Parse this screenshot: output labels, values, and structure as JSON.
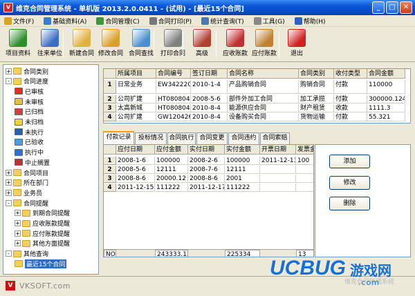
{
  "window": {
    "title": "维克合同管理系统 - 单机版 2013.2.0.0411 - (试用) - [最近15个合同]",
    "icon_text": "V"
  },
  "menu": [
    {
      "label": "文件(F)",
      "color": "#d9a02a"
    },
    {
      "label": "基础资料(A)",
      "color": "#3a7bd5"
    },
    {
      "label": "合同管理(C)",
      "color": "#3a9a3a"
    },
    {
      "label": "合同打印(P)",
      "color": "#777777"
    },
    {
      "label": "统计查询(T)",
      "color": "#4a7ab5"
    },
    {
      "label": "工具(G)",
      "color": "#888888"
    },
    {
      "label": "帮助(H)",
      "color": "#3060c0"
    }
  ],
  "toolbar": [
    {
      "label": "项目资料",
      "color": "#2f8f2f"
    },
    {
      "label": "往来单位",
      "color": "#3c6fc2"
    },
    {
      "label": "新建合同",
      "color": "#e0b040"
    },
    {
      "label": "修改合同",
      "color": "#d9a02a"
    },
    {
      "label": "合同查找",
      "color": "#4a90d0"
    },
    {
      "label": "打印合同",
      "color": "#808080"
    },
    {
      "label": "高级",
      "color": "#b04030"
    },
    {
      "label": "应收账款",
      "color": "#c03030"
    },
    {
      "label": "应付账款",
      "color": "#c08030"
    },
    {
      "label": "退出",
      "color": "#d02020"
    }
  ],
  "tree": [
    {
      "label": "合同类别",
      "level": 0,
      "expander": "+"
    },
    {
      "label": "合同进度",
      "level": 0,
      "expander": "-"
    },
    {
      "label": "已审核",
      "level": 1,
      "color": "#e03020"
    },
    {
      "label": "未审核",
      "level": 1,
      "color": "#e0c040"
    },
    {
      "label": "已归档",
      "level": 1,
      "color": "#d04040"
    },
    {
      "label": "未归档",
      "level": 1,
      "color": "#f0d040"
    },
    {
      "label": "未执行",
      "level": 1,
      "color": "#2060c0"
    },
    {
      "label": "已验收",
      "level": 1,
      "color": "#40a0e0"
    },
    {
      "label": "执行中",
      "level": 1,
      "color": "#3070d0"
    },
    {
      "label": "中止搁置",
      "level": 1,
      "color": "#c03030"
    },
    {
      "label": "合同项目",
      "level": 0,
      "expander": "+"
    },
    {
      "label": "所在部门",
      "level": 0,
      "expander": "+"
    },
    {
      "label": "业务员",
      "level": 0,
      "expander": "+"
    },
    {
      "label": "合同提醒",
      "level": 0,
      "expander": "-"
    },
    {
      "label": "到期合同提醒",
      "level": 1,
      "expander": "+"
    },
    {
      "label": "应收账款提醒",
      "level": 1,
      "expander": "+"
    },
    {
      "label": "应付账款提醒",
      "level": 1,
      "expander": "+"
    },
    {
      "label": "其他方面提醒",
      "level": 1,
      "expander": "+"
    },
    {
      "label": "其他查询",
      "level": 0,
      "expander": "-"
    },
    {
      "label": "最近15个合同",
      "level": 1,
      "selected": true
    }
  ],
  "contracts": {
    "columns": [
      "所属项目",
      "合同编号",
      "签订日期",
      "合同名称",
      "合同类别",
      "收付类型",
      "合同金额"
    ],
    "rows": [
      {
        "num": "1",
        "cells": [
          "日常业务",
          "EW34222090",
          "2010-1-4",
          "产品购销合同",
          "购销合同",
          "付款",
          "110000"
        ]
      },
      {
        "num": "2",
        "cells": [
          "公司扩建",
          "HT080804A1",
          "2008-5-6",
          "部件外加工合同",
          "加工承揽",
          "付款",
          "300000.124"
        ]
      },
      {
        "num": "3",
        "cells": [
          "太高新城",
          "HT080804B",
          "2010-8-4",
          "能源供应合同",
          "财产租赁",
          "收款",
          "1111.3"
        ]
      },
      {
        "num": "4",
        "cells": [
          "公司扩建",
          "GW12042601",
          "2010-8-4",
          "设备购买合同",
          "货物运输",
          "付款",
          "55.321"
        ]
      }
    ]
  },
  "tabs": [
    "付款记录",
    "投标情况",
    "合同执行",
    "合同变更",
    "合同违约",
    "合同索赔"
  ],
  "payments": {
    "columns": [
      "应付日期",
      "应付金额",
      "实付日期",
      "实付金额",
      "开票日期",
      "发票金"
    ],
    "rows": [
      {
        "num": "1",
        "cells": [
          "2008-1-6",
          "100000",
          "2008-2-6",
          "100000",
          "2011-12-13",
          "100"
        ]
      },
      {
        "num": "2",
        "cells": [
          "2008-5-6",
          "12111",
          "2008-7-6",
          "12111",
          "",
          ""
        ]
      },
      {
        "num": "3",
        "cells": [
          "2008-8-6",
          "20000.12",
          "2008-8-6",
          "2001",
          "",
          ""
        ]
      },
      {
        "num": "4",
        "cells": [
          "2011-12-15",
          "111222",
          "2011-12-17",
          "111222",
          "",
          ""
        ]
      }
    ],
    "footer": {
      "num_label": "NO",
      "planned_total": "243333.12",
      "actual_total": "225334",
      "extra": "13"
    }
  },
  "actions": {
    "add": "添加",
    "edit": "修改",
    "delete": "删除"
  },
  "status": {
    "logo_letter": "V",
    "brand": "VKSOFT.com",
    "ghost_text": "维克合同管理系统"
  },
  "watermark": {
    "logo": "UCBUG",
    "cn": "游戏网",
    "url": ".com"
  }
}
